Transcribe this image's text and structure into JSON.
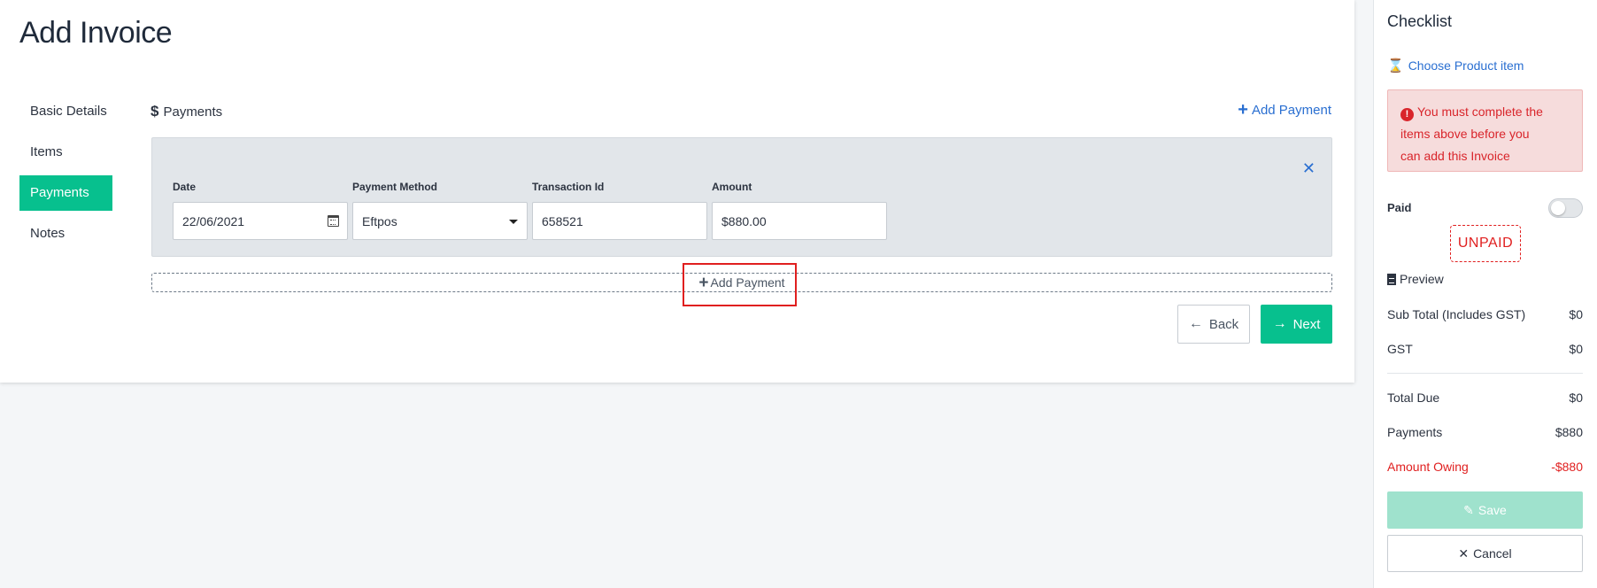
{
  "page": {
    "title": "Add Invoice"
  },
  "nav": {
    "items": [
      {
        "label": "Basic Details",
        "active": false
      },
      {
        "label": "Items",
        "active": false
      },
      {
        "label": "Payments",
        "active": true
      },
      {
        "label": "Notes",
        "active": false
      }
    ]
  },
  "payments": {
    "section_title": "Payments",
    "add_link_label": "Add Payment",
    "add_bar_label": "Add Payment",
    "row": {
      "date_label": "Date",
      "date_value": "22/06/2021",
      "method_label": "Payment Method",
      "method_value": "Eftpos",
      "txn_label": "Transaction Id",
      "txn_value": "658521",
      "amount_label": "Amount",
      "amount_value": "$880.00"
    }
  },
  "actions": {
    "back_label": "Back",
    "next_label": "Next"
  },
  "checklist": {
    "title": "Checklist",
    "item_label": "Choose Product item",
    "alert_line1": "You must complete the",
    "alert_line2": "items above before you",
    "alert_line3": "can add this Invoice",
    "paid_label": "Paid",
    "paid_on": false,
    "status_stamp": "UNPAID",
    "preview_label": "Preview",
    "summary": [
      {
        "label": "Sub Total (Includes GST)",
        "value": "$0"
      },
      {
        "label": "GST",
        "value": "$0"
      },
      {
        "label": "Total Due",
        "value": "$0"
      },
      {
        "label": "Payments",
        "value": "$880"
      },
      {
        "label": "Amount Owing",
        "value": "-$880"
      }
    ],
    "save_label": "Save",
    "cancel_label": "Cancel"
  },
  "colors": {
    "accent_green": "#07c08e",
    "link_blue": "#2a6fd1",
    "danger_red": "#e01f1f",
    "alert_bg": "#f6dcdc"
  }
}
